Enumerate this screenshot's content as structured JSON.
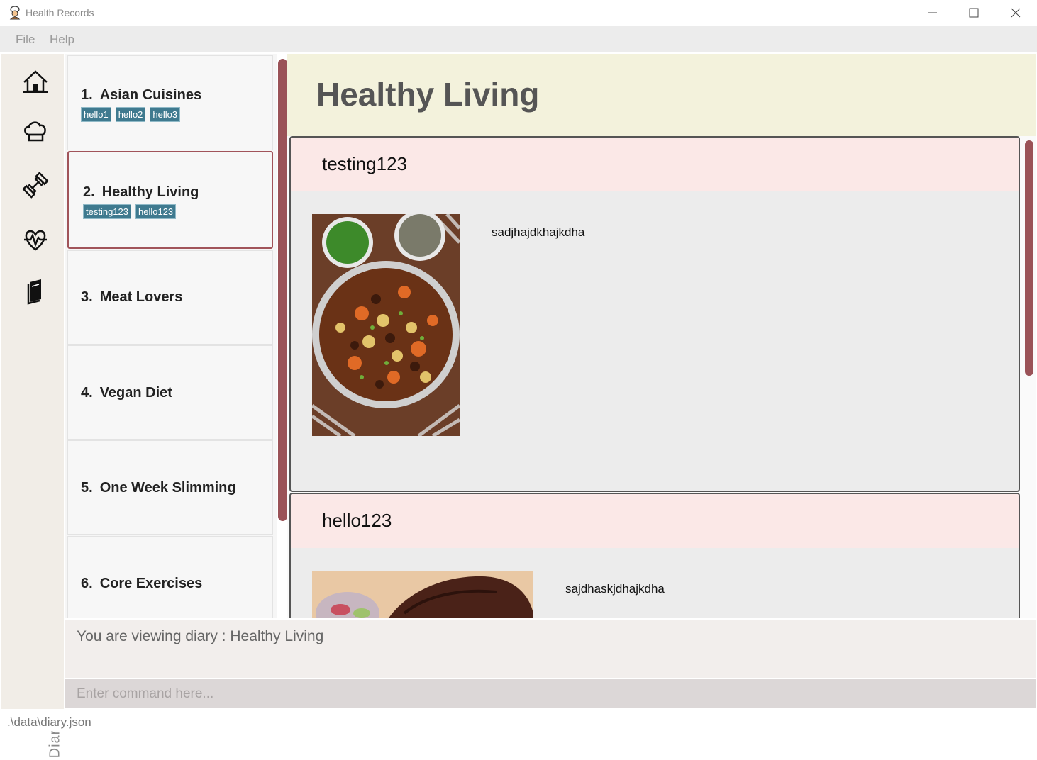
{
  "window": {
    "title": "Health Records",
    "minimize_icon": "minimize-icon",
    "maximize_icon": "maximize-icon",
    "close_icon": "close-icon"
  },
  "menu": {
    "items": [
      "File",
      "Help"
    ]
  },
  "sidebar": {
    "icons": [
      "home-icon",
      "chef-hat-icon",
      "dumbbell-icon",
      "heartbeat-icon",
      "book-icon"
    ],
    "vertical_label": "Diary"
  },
  "diaries": [
    {
      "num": "1.",
      "name": "Asian Cuisines",
      "tags": [
        "hello1",
        "hello2",
        "hello3"
      ]
    },
    {
      "num": "2.",
      "name": "Healthy Living",
      "tags": [
        "testing123",
        "hello123"
      ],
      "selected": true
    },
    {
      "num": "3.",
      "name": "Meat Lovers",
      "tags": []
    },
    {
      "num": "4.",
      "name": "Vegan Diet",
      "tags": []
    },
    {
      "num": "5.",
      "name": "One Week Slimming",
      "tags": []
    },
    {
      "num": "6.",
      "name": "Core Exercises",
      "tags": []
    }
  ],
  "detail": {
    "title": "Healthy Living",
    "entries": [
      {
        "title": "testing123",
        "text": "sadjhajdkhajkdha",
        "image": "beef-stew-photo"
      },
      {
        "title": "hello123",
        "text": "sajdhaskjdhajkdha",
        "image": "steak-photo"
      }
    ]
  },
  "result": {
    "text": "You are viewing diary : Healthy Living"
  },
  "command": {
    "placeholder": "Enter command here..."
  },
  "status": {
    "path": ".\\data\\diary.json"
  },
  "colors": {
    "accent": "#9a5257",
    "tag": "#3f7a8f",
    "header": "#f3f2dc",
    "entry_header": "#fbe8e7"
  }
}
